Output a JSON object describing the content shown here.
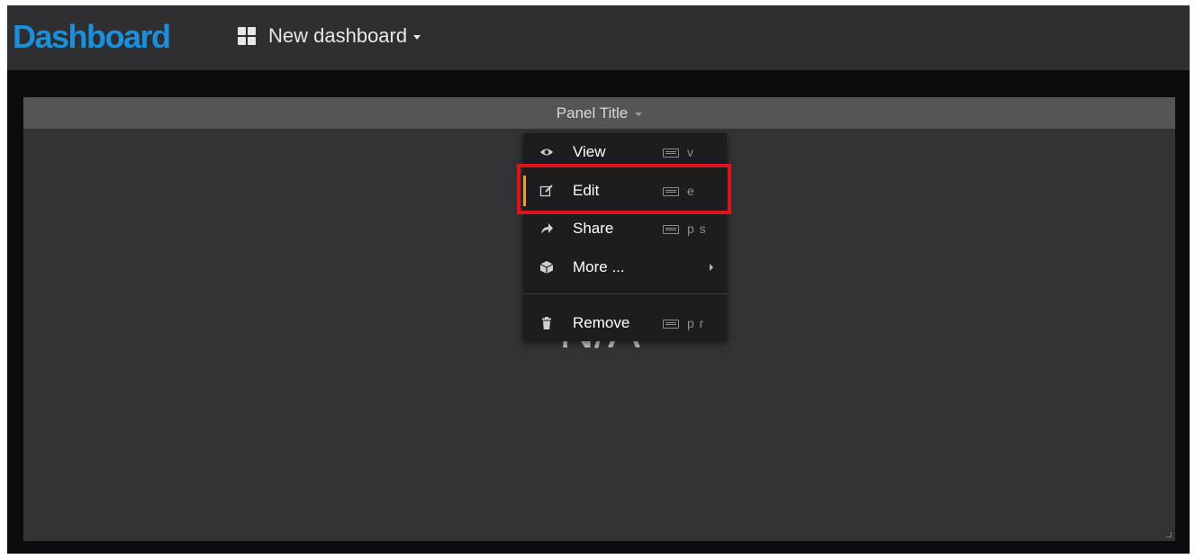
{
  "header": {
    "brand": "Dashboard",
    "dashboard_icon": "grid-icon",
    "dashboard_title": "New dashboard"
  },
  "panel": {
    "title": "Panel Title",
    "value": "N/A"
  },
  "menu": {
    "items": [
      {
        "label": "View",
        "icon": "eye-icon",
        "shortcut": "v"
      },
      {
        "label": "Edit",
        "icon": "edit-icon",
        "shortcut": "e"
      },
      {
        "label": "Share",
        "icon": "share-icon",
        "shortcut": "p s"
      },
      {
        "label": "More ...",
        "icon": "cube-icon"
      },
      {
        "label": "Remove",
        "icon": "trash-icon",
        "shortcut": "p r"
      }
    ]
  },
  "colors": {
    "brand": "#1a8fdc",
    "active_stripe": "#e8a12b",
    "highlight_box": "#e0131a"
  }
}
